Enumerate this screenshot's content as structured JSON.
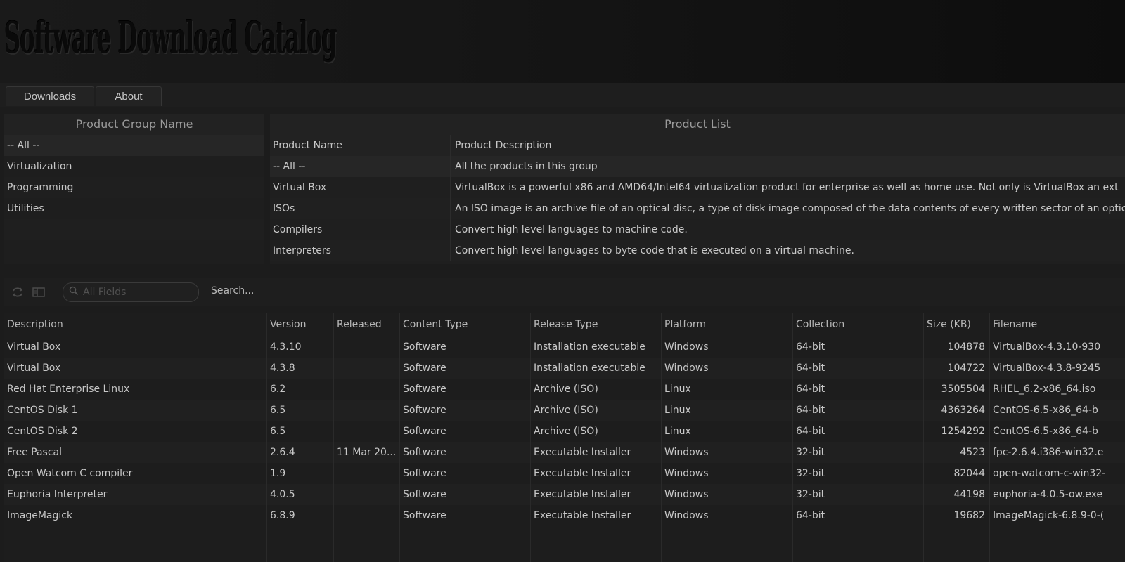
{
  "app": {
    "title": "Software Download Catalog"
  },
  "tabs": [
    {
      "label": "Downloads"
    },
    {
      "label": "About"
    }
  ],
  "groups": {
    "title": "Product Group Name",
    "items": [
      "-- All --",
      "Virtualization",
      "Programming",
      "Utilities"
    ]
  },
  "products": {
    "title": "Product List",
    "columns": [
      "Product Name",
      "Product Description"
    ],
    "rows": [
      {
        "name": "-- All --",
        "desc": "All the products in this group"
      },
      {
        "name": "Virtual Box",
        "desc": "VirtualBox is a powerful x86 and AMD64/Intel64 virtualization product for enterprise as well as home use. Not only is VirtualBox an ext"
      },
      {
        "name": "ISOs",
        "desc": "An ISO image is an archive file of an optical disc, a type of disk image composed of the data contents of every written sector of an optic"
      },
      {
        "name": "Compilers",
        "desc": "Convert high level languages to machine code."
      },
      {
        "name": "Interpreters",
        "desc": "Convert high level languages to byte code that is executed on a virtual machine."
      }
    ]
  },
  "toolbar": {
    "search_placeholder": "All Fields",
    "search_label": "Search..."
  },
  "downloads": {
    "columns": [
      "Description",
      "Version",
      "Released",
      "Content Type",
      "Release Type",
      "Platform",
      "Collection",
      "Size (KB)",
      "Filename"
    ],
    "rows": [
      [
        "Virtual Box",
        "4.3.10",
        "",
        "Software",
        "Installation executable",
        "Windows",
        "64-bit",
        "104878",
        "VirtualBox-4.3.10-930"
      ],
      [
        "Virtual Box",
        "4.3.8",
        "",
        "Software",
        "Installation executable",
        "Windows",
        "64-bit",
        "104722",
        "VirtualBox-4.3.8-9245"
      ],
      [
        "Red Hat Enterprise Linux",
        "6.2",
        "",
        "Software",
        "Archive (ISO)",
        "Linux",
        "64-bit",
        "3505504",
        "RHEL_6.2-x86_64.iso"
      ],
      [
        "CentOS Disk 1",
        "6.5",
        "",
        "Software",
        "Archive (ISO)",
        "Linux",
        "64-bit",
        "4363264",
        "CentOS-6.5-x86_64-b"
      ],
      [
        "CentOS Disk 2",
        "6.5",
        "",
        "Software",
        "Archive (ISO)",
        "Linux",
        "64-bit",
        "1254292",
        "CentOS-6.5-x86_64-b"
      ],
      [
        "Free Pascal",
        "2.6.4",
        "11 Mar 20...",
        "Software",
        "Executable Installer",
        "Windows",
        "32-bit",
        "4523",
        "fpc-2.6.4.i386-win32.e"
      ],
      [
        "Open Watcom C compiler",
        "1.9",
        "",
        "Software",
        "Executable Installer",
        "Windows",
        "32-bit",
        "82044",
        "open-watcom-c-win32-"
      ],
      [
        "Euphoria Interpreter",
        "4.0.5",
        "",
        "Software",
        "Executable Installer",
        "Windows",
        "32-bit",
        "44198",
        "euphoria-4.0.5-ow.exe"
      ],
      [
        "ImageMagick",
        "6.8.9",
        "",
        "Software",
        "Executable Installer",
        "Windows",
        "64-bit",
        "19682",
        "ImageMagick-6.8.9-0-("
      ]
    ]
  }
}
